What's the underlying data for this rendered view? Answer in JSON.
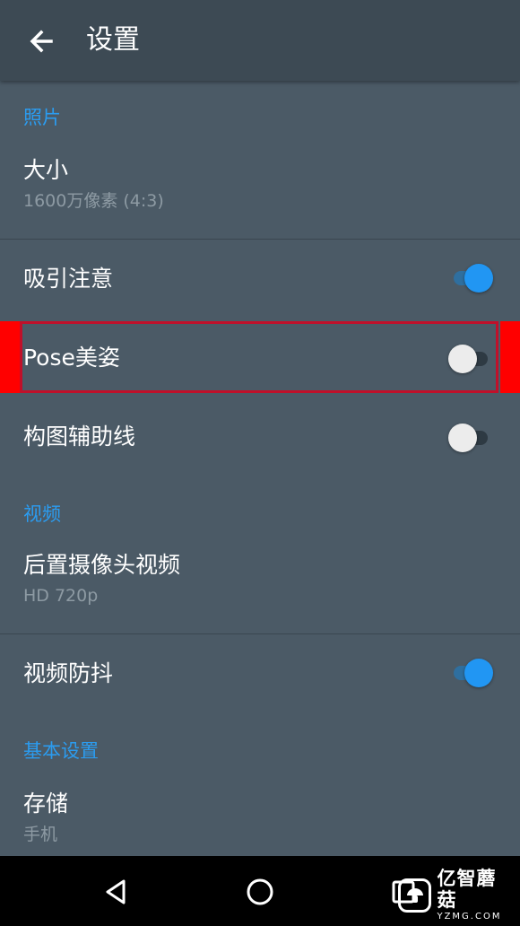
{
  "header": {
    "back_icon": "arrow-left-icon",
    "title": "设置"
  },
  "sections": {
    "photo": {
      "header": "照片",
      "size": {
        "title": "大小",
        "value": "1600万像素 (4:3)"
      },
      "attention": {
        "title": "吸引注意",
        "toggle": "on"
      },
      "pose": {
        "title": "Pose美姿",
        "toggle": "off"
      },
      "grid": {
        "title": "构图辅助线",
        "toggle": "off"
      }
    },
    "video": {
      "header": "视频",
      "rear_video": {
        "title": "后置摄像头视频",
        "value": "HD 720p"
      },
      "stabilization": {
        "title": "视频防抖",
        "toggle": "on"
      }
    },
    "basic": {
      "header": "基本设置",
      "storage": {
        "title": "存储",
        "value": "手机"
      }
    }
  },
  "navbar": {
    "back_icon": "triangle-back-icon",
    "home_icon": "circle-home-icon",
    "recents_icon": "square-recents-icon"
  },
  "watermark": {
    "name": "亿智蘑菇",
    "site": "YZMG.COM"
  },
  "colors": {
    "accent": "#2196f3",
    "section_header": "#2b9cf0",
    "background": "#4b5a66",
    "appbar": "#3d4a54",
    "highlight": "#c0102a",
    "side_marker": "#ff0000"
  }
}
